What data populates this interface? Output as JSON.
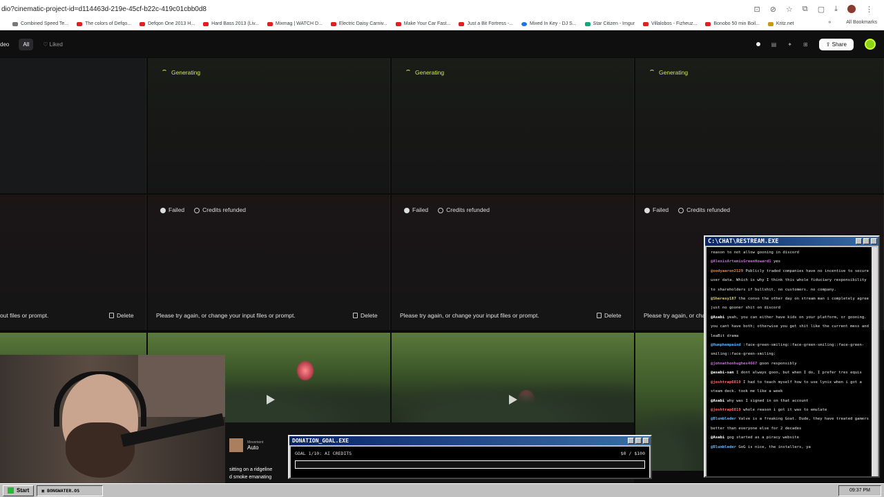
{
  "browser": {
    "url": "dio?cinematic-project-id=d114463d-219e-45cf-b22c-419c01cbb0d8",
    "bookmarks": [
      "Combined Speed Te...",
      "The colors of Defqo...",
      "Defqon One 2013 H...",
      "Hard Bass 2013 (Liv...",
      "Mixmag | WATCH D...",
      "Electric Daisy Carniv...",
      "Make Your Car Fast...",
      "Just a Bit Fortress -...",
      "Mixed In Key - DJ S...",
      "Star Citizen - Imgur",
      "Villalobos - Fizheuz...",
      "Bonobo 50 min Boil...",
      "Kritz.net"
    ],
    "all_bookmarks": "All Bookmarks"
  },
  "header": {
    "left_trunc": "deo",
    "tab_all": "All",
    "tab_liked": "Liked",
    "share": "Share"
  },
  "generating_label": "Generating",
  "failed": {
    "status": "Failed",
    "refund": "Credits refunded",
    "retry_full": "Please try again, or change your input files or prompt.",
    "retry_left_trunc": "out files or prompt.",
    "retry_right_trunc": "Please try again, or chan",
    "delete": "Delete"
  },
  "music": {
    "label": "Movement",
    "track": "Auto"
  },
  "caption": {
    "line1": "sitting on a ridgeline",
    "line2": "d smoke emanating"
  },
  "donation": {
    "title": "DONATION_GOAL.EXE",
    "goal": "GOAL 1/10: AI CREDITS",
    "amount": "$0 / $100",
    "progress_fraction": 0.0
  },
  "chat": {
    "title": "C:\\CHAT\\RESTREAM.EXE",
    "messages": [
      {
        "user": "",
        "text": "reason to not allow gooning in discord",
        "color": "#ffffff"
      },
      {
        "user": "@AlexisArtemisGreenHoward1",
        "text": "yes",
        "color": "#c86dd7"
      },
      {
        "user": "@oodyaaron2129",
        "text": "Publicly traded companies have no incentive to secure user data. Which is why I think this whole fiduciary responsibility to shareholders if bullshit. no customers. no company.",
        "color": "#e08a3a"
      },
      {
        "user": "@Sheresy187",
        "text": "the convo the other day on stream man i completely agree just no gooner shit on discord",
        "color": "#e0d070"
      },
      {
        "user": "@Asabi",
        "text": "yeah, you can either have kids on your platform, or gooning. you cant have both; otherwise you get shit like the current mess and leaBit drama",
        "color": "#ffffff"
      },
      {
        "user": "@Humphempaind",
        "text": ":face-green-smiling::face-green-smiling::face-green-smiling::face-green-smiling:",
        "color": "#62b5ff"
      },
      {
        "user": "@johnathonhughes4667",
        "text": "goon responsibly",
        "color": "#c86dd7"
      },
      {
        "user": "@asabi-san",
        "text": "I dont always goon, but when I do, I prefer tres equis",
        "color": "#ffffff"
      },
      {
        "user": "@joshtrap6819",
        "text": "I had to teach myself how to use lynix when i got a steam deck. took me like a week",
        "color": "#ff6d6d"
      },
      {
        "user": "@Asabi",
        "text": "why was I signed in on that account",
        "color": "#ffffff"
      },
      {
        "user": "@joshtrap6819",
        "text": "whole reason i got it was to emulate",
        "color": "#ff6d6d"
      },
      {
        "user": "@Blumbleder",
        "text": "Valve is a freaking Goat. Dude, they have treated gamers better than everyone else for 2 decades",
        "color": "#62b5ff"
      },
      {
        "user": "@Asabi",
        "text": "gog started as a piracy website",
        "color": "#ffffff"
      },
      {
        "user": "@Blumbleder",
        "text": "GoG is nice, the installers, ya",
        "color": "#62b5ff"
      }
    ]
  },
  "taskbar": {
    "start": "Start",
    "task": "BONGWATER.OS",
    "clock": "09:37 PM"
  },
  "colors": {
    "accent_green": "#c8ff2c",
    "generating": "#cfe85a"
  }
}
